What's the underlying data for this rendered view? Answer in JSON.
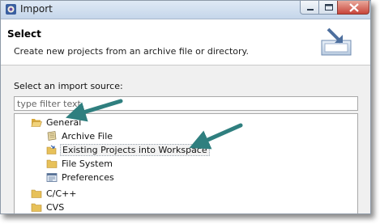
{
  "window": {
    "title": "Import",
    "icon": "import-app-icon",
    "controls": [
      "minimize-icon",
      "maximize-icon",
      "close-icon"
    ]
  },
  "header": {
    "title": "Select",
    "description": "Create new projects from an archive file or directory.",
    "icon": "import-wizard-icon"
  },
  "source": {
    "label": "Select an import source:",
    "filter_placeholder": "type filter text"
  },
  "tree": {
    "items": [
      {
        "label": "General",
        "icon": "folder-open-icon",
        "level": 0
      },
      {
        "label": "Archive File",
        "icon": "archive-file-icon",
        "level": 1
      },
      {
        "label": "Existing Projects into Workspace",
        "icon": "existing-projects-icon",
        "level": 1,
        "selected": true
      },
      {
        "label": "File System",
        "icon": "folder-icon",
        "level": 1
      },
      {
        "label": "Preferences",
        "icon": "preferences-icon",
        "level": 1
      },
      {
        "label": "C/C++",
        "icon": "folder-icon",
        "level": 0
      },
      {
        "label": "CVS",
        "icon": "folder-icon",
        "level": 0
      }
    ]
  },
  "colors": {
    "titlebar": "#c5d6ea",
    "arrow": "#2f7f7f",
    "folder": "#e7c15a"
  }
}
